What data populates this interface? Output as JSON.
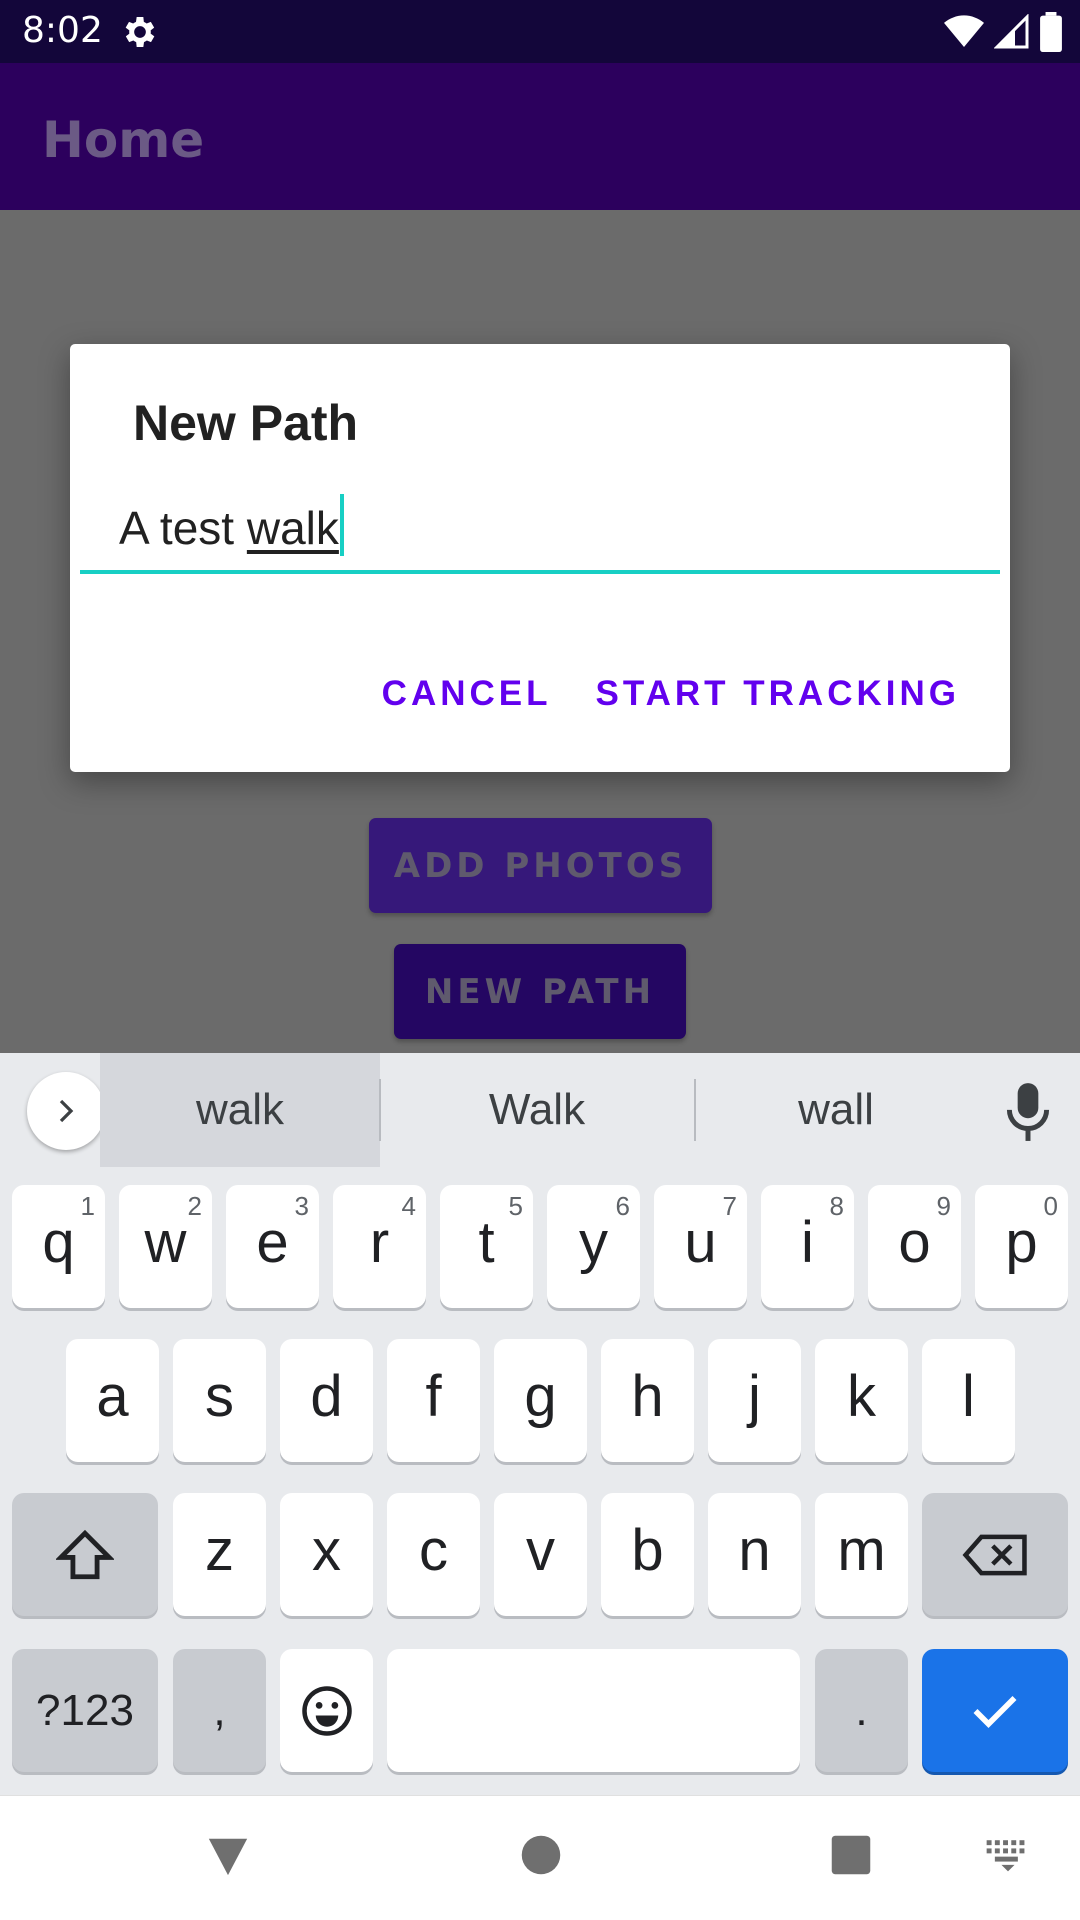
{
  "status_bar": {
    "time": "8:02"
  },
  "app_bar": {
    "title": "Home"
  },
  "main": {
    "add_photos_label": "ADD PHOTOS",
    "new_path_label": "NEW PATH"
  },
  "dialog": {
    "title": "New Path",
    "input_value_plain": "A test ",
    "input_value_composing": "walk",
    "cancel_label": "CANCEL",
    "start_label": "START TRACKING",
    "accent_color": "#17cfc4",
    "button_color": "#6200ee"
  },
  "keyboard": {
    "suggestions": [
      "walk",
      "Walk",
      "wall"
    ],
    "row1": [
      {
        "letter": "q",
        "hint": "1"
      },
      {
        "letter": "w",
        "hint": "2"
      },
      {
        "letter": "e",
        "hint": "3"
      },
      {
        "letter": "r",
        "hint": "4"
      },
      {
        "letter": "t",
        "hint": "5"
      },
      {
        "letter": "y",
        "hint": "6"
      },
      {
        "letter": "u",
        "hint": "7"
      },
      {
        "letter": "i",
        "hint": "8"
      },
      {
        "letter": "o",
        "hint": "9"
      },
      {
        "letter": "p",
        "hint": "0"
      }
    ],
    "row2": [
      "a",
      "s",
      "d",
      "f",
      "g",
      "h",
      "j",
      "k",
      "l"
    ],
    "row3": [
      "z",
      "x",
      "c",
      "v",
      "b",
      "n",
      "m"
    ],
    "symbols_label": "?123",
    "comma_label": ",",
    "period_label": ".",
    "icons": [
      "chevron-right-icon",
      "mic-icon",
      "shift-icon",
      "backspace-icon",
      "emoji-icon",
      "check-icon"
    ]
  },
  "nav_bar": {
    "icons": [
      "back-icon",
      "home-icon",
      "recents-icon",
      "keyboard-switch-icon"
    ]
  }
}
